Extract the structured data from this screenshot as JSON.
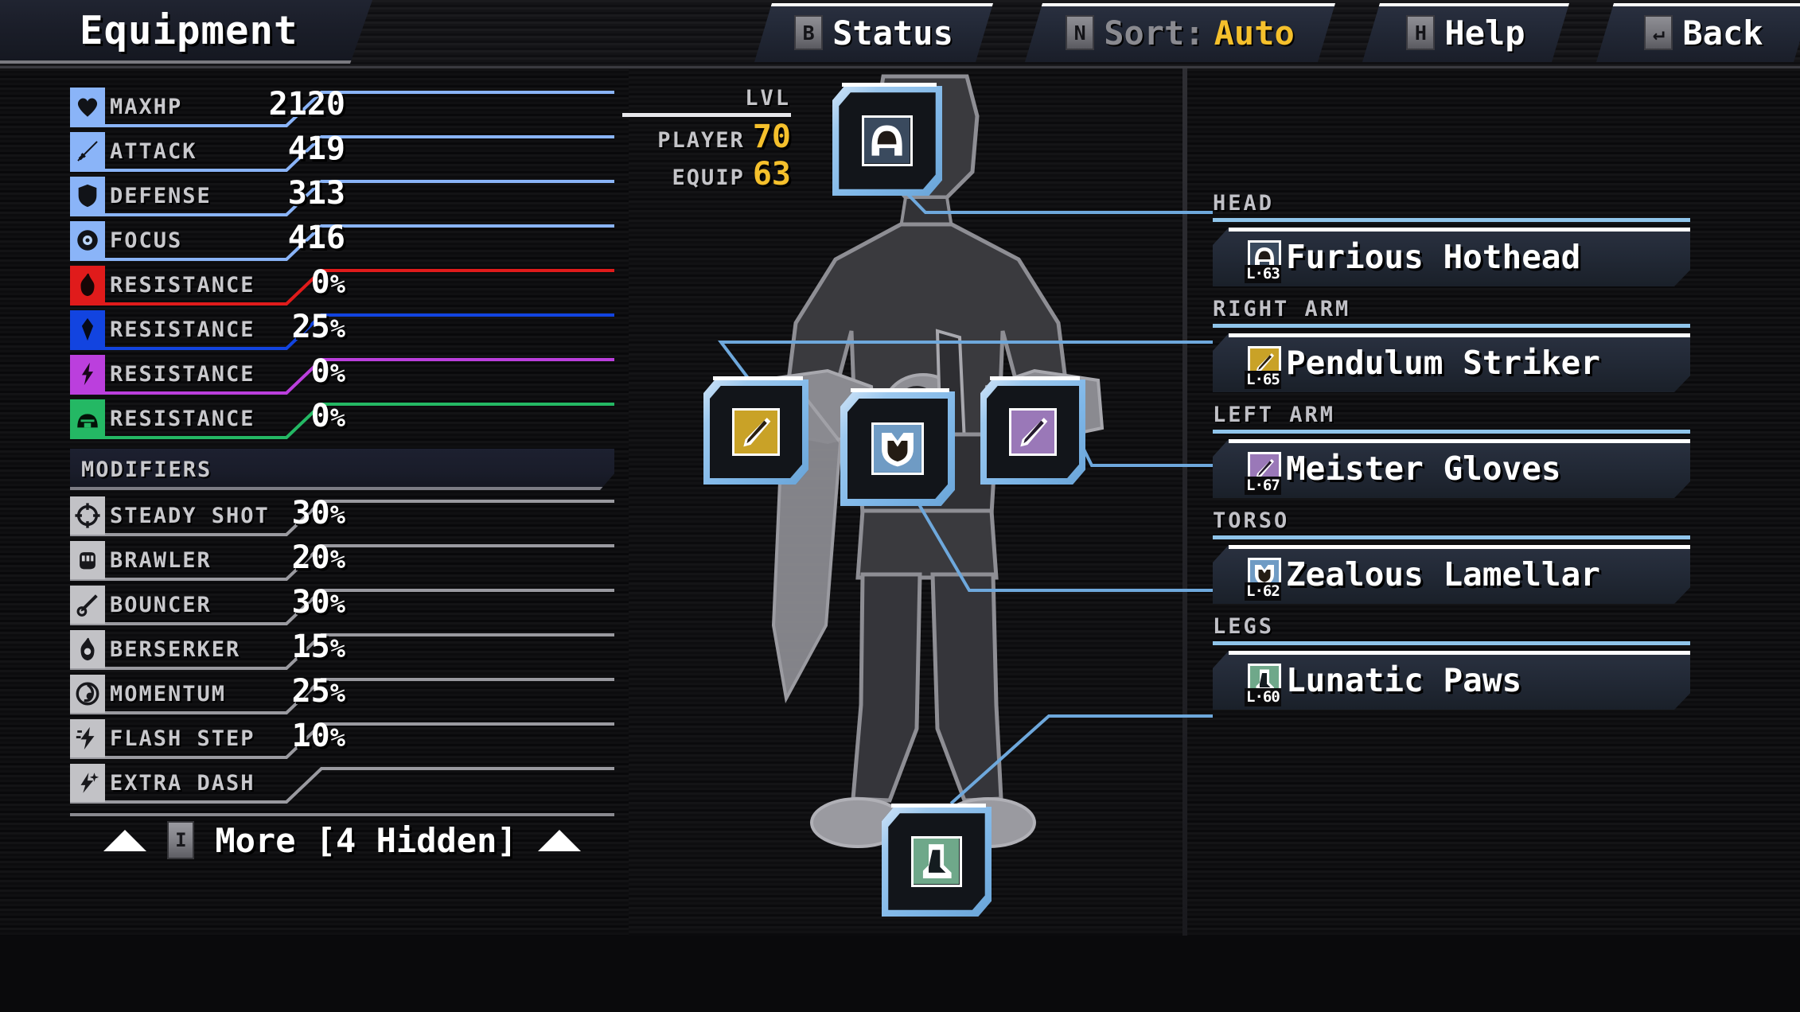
{
  "header": {
    "title": "Equipment",
    "buttons": [
      {
        "key": "B",
        "label": "Status",
        "value": "",
        "name": "status-button"
      },
      {
        "key": "N",
        "label": "Sort:",
        "value": "Auto",
        "name": "sort-button"
      },
      {
        "key": "H",
        "label": "Help",
        "value": "",
        "name": "help-button"
      },
      {
        "key": "↵",
        "label": "Back",
        "value": "",
        "name": "back-button"
      }
    ]
  },
  "stats": [
    {
      "icon": "heart-icon",
      "label": "MAXHP",
      "value": "2120",
      "unit": "",
      "color": "#8ab4f8"
    },
    {
      "icon": "sword-icon",
      "label": "ATTACK",
      "value": "419",
      "unit": "",
      "color": "#8ab4f8"
    },
    {
      "icon": "shield-icon",
      "label": "DEFENSE",
      "value": "313",
      "unit": "",
      "color": "#8ab4f8"
    },
    {
      "icon": "focus-icon",
      "label": "FOCUS",
      "value": "416",
      "unit": "",
      "color": "#8ab4f8"
    },
    {
      "icon": "fire-icon",
      "label": "RESISTANCE",
      "value": "0",
      "unit": "%",
      "color": "#e01b1b"
    },
    {
      "icon": "ice-icon",
      "label": "RESISTANCE",
      "value": "25",
      "unit": "%",
      "color": "#1244e0"
    },
    {
      "icon": "lightning-icon",
      "label": "RESISTANCE",
      "value": "0",
      "unit": "%",
      "color": "#bb3fdd"
    },
    {
      "icon": "poison-icon",
      "label": "RESISTANCE",
      "value": "0",
      "unit": "%",
      "color": "#24b864"
    }
  ],
  "modifiers_header": "MODIFIERS",
  "modifiers": [
    {
      "icon": "steady-shot-icon",
      "label": "STEADY SHOT",
      "value": "30",
      "unit": "%"
    },
    {
      "icon": "brawler-icon",
      "label": "BRAWLER",
      "value": "20",
      "unit": "%"
    },
    {
      "icon": "bouncer-icon",
      "label": "BOUNCER",
      "value": "30",
      "unit": "%"
    },
    {
      "icon": "berserker-icon",
      "label": "BERSERKER",
      "value": "15",
      "unit": "%"
    },
    {
      "icon": "momentum-icon",
      "label": "MOMENTUM",
      "value": "25",
      "unit": "%"
    },
    {
      "icon": "flash-step-icon",
      "label": "FLASH STEP",
      "value": "10",
      "unit": "%"
    },
    {
      "icon": "extra-dash-icon",
      "label": "EXTRA DASH",
      "value": "",
      "unit": ""
    }
  ],
  "more_bar": {
    "key": "I",
    "label": "More [4 Hidden]"
  },
  "level": {
    "title": "LVL",
    "player_label": "PLAYER",
    "player_value": "70",
    "equip_label": "EQUIP",
    "equip_value": "63"
  },
  "equipment": [
    {
      "slot": "HEAD",
      "name": "Furious Hothead",
      "level": "L·63",
      "color": "#3a4a5e",
      "icon": "helmet-icon"
    },
    {
      "slot": "RIGHT ARM",
      "name": "Pendulum Striker",
      "level": "L·65",
      "color": "#c9a227",
      "icon": "weapon-icon"
    },
    {
      "slot": "LEFT ARM",
      "name": "Meister Gloves",
      "level": "L·67",
      "color": "#9a78b8",
      "icon": "glove-icon"
    },
    {
      "slot": "TORSO",
      "name": "Zealous Lamellar",
      "level": "L·62",
      "color": "#6f9bc4",
      "icon": "armor-icon"
    },
    {
      "slot": "LEGS",
      "name": "Lunatic Paws",
      "level": "L·60",
      "color": "#6fa88a",
      "icon": "boots-icon"
    }
  ],
  "slots": [
    {
      "part": "head",
      "icon": "helmet-icon",
      "color": "#3a4a5e"
    },
    {
      "part": "right-arm",
      "icon": "weapon-icon",
      "color": "#c9a227"
    },
    {
      "part": "torso",
      "icon": "armor-icon",
      "color": "#6f9bc4"
    },
    {
      "part": "left-arm",
      "icon": "glove-icon",
      "color": "#9a78b8"
    },
    {
      "part": "legs",
      "icon": "boots-icon",
      "color": "#6fa88a"
    }
  ]
}
